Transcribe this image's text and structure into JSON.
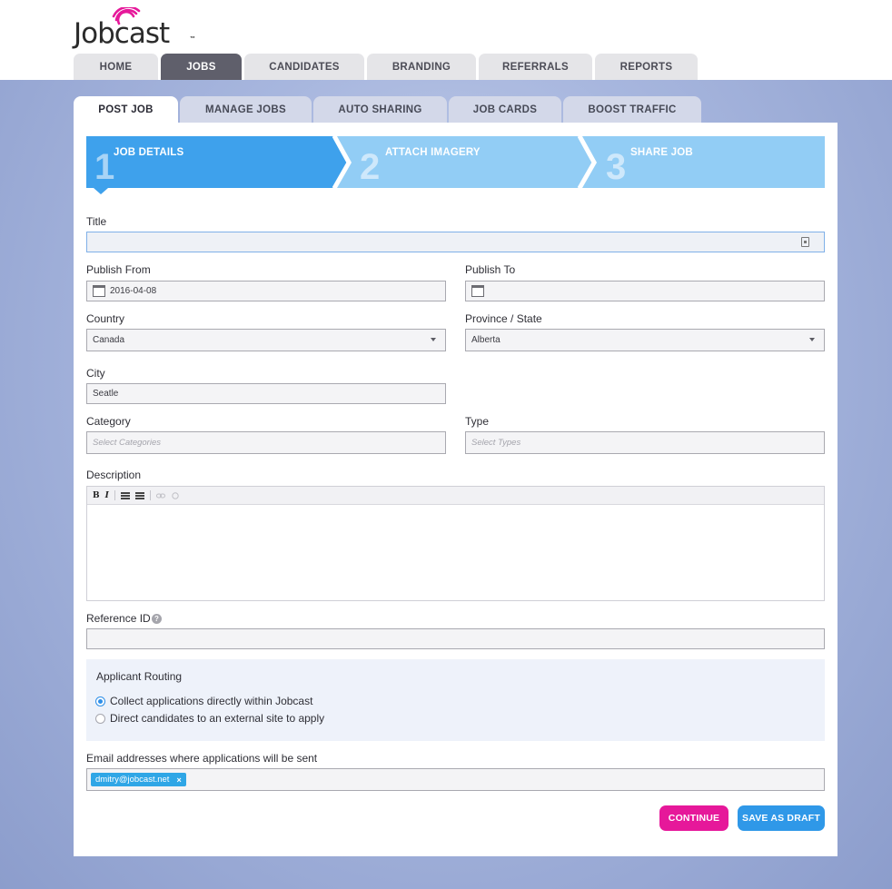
{
  "brand": {
    "name": "Jobcast",
    "tm": "™"
  },
  "main_tabs": [
    {
      "label": "HOME",
      "active": false
    },
    {
      "label": "JOBS",
      "active": true
    },
    {
      "label": "CANDIDATES",
      "active": false
    },
    {
      "label": "BRANDING",
      "active": false
    },
    {
      "label": "REFERRALS",
      "active": false
    },
    {
      "label": "REPORTS",
      "active": false
    }
  ],
  "sub_tabs": [
    {
      "label": "POST JOB",
      "active": true
    },
    {
      "label": "MANAGE JOBS",
      "active": false
    },
    {
      "label": "AUTO SHARING",
      "active": false
    },
    {
      "label": "JOB CARDS",
      "active": false
    },
    {
      "label": "BOOST TRAFFIC",
      "active": false
    }
  ],
  "wizard": {
    "steps": [
      {
        "num": "1",
        "label": "JOB DETAILS",
        "active": true
      },
      {
        "num": "2",
        "label": "ATTACH IMAGERY",
        "active": false
      },
      {
        "num": "3",
        "label": "SHARE JOB",
        "active": false
      }
    ]
  },
  "form": {
    "title": {
      "label": "Title",
      "value": ""
    },
    "publish_from": {
      "label": "Publish From",
      "value": "2016-04-08"
    },
    "publish_to": {
      "label": "Publish To",
      "value": ""
    },
    "country": {
      "label": "Country",
      "value": "Canada"
    },
    "province": {
      "label": "Province / State",
      "value": "Alberta"
    },
    "city": {
      "label": "City",
      "value": "Seatle"
    },
    "category": {
      "label": "Category",
      "placeholder": "Select Categories"
    },
    "type": {
      "label": "Type",
      "placeholder": "Select Types"
    },
    "description": {
      "label": "Description",
      "toolbar": {
        "bold": "B",
        "italic": "I"
      }
    },
    "reference_id": {
      "label": "Reference ID",
      "help": "?",
      "value": ""
    },
    "routing": {
      "title": "Applicant Routing",
      "options": [
        {
          "label": "Collect applications directly within Jobcast",
          "selected": true
        },
        {
          "label": "Direct candidates to an external site to apply",
          "selected": false
        }
      ]
    },
    "emails": {
      "label": "Email addresses where applications will be sent",
      "tags": [
        {
          "value": "dmitry@jobcast.net",
          "remove": "×"
        }
      ]
    }
  },
  "actions": {
    "continue": "CONTINUE",
    "save_draft": "SAVE AS DRAFT"
  },
  "colors": {
    "brand_pink": "#e6189a",
    "accent_blue": "#2f98e8",
    "wizard_active": "#3ea1ec",
    "wizard_inactive": "#92cdf5",
    "tab_active": "#5f5f6b"
  }
}
